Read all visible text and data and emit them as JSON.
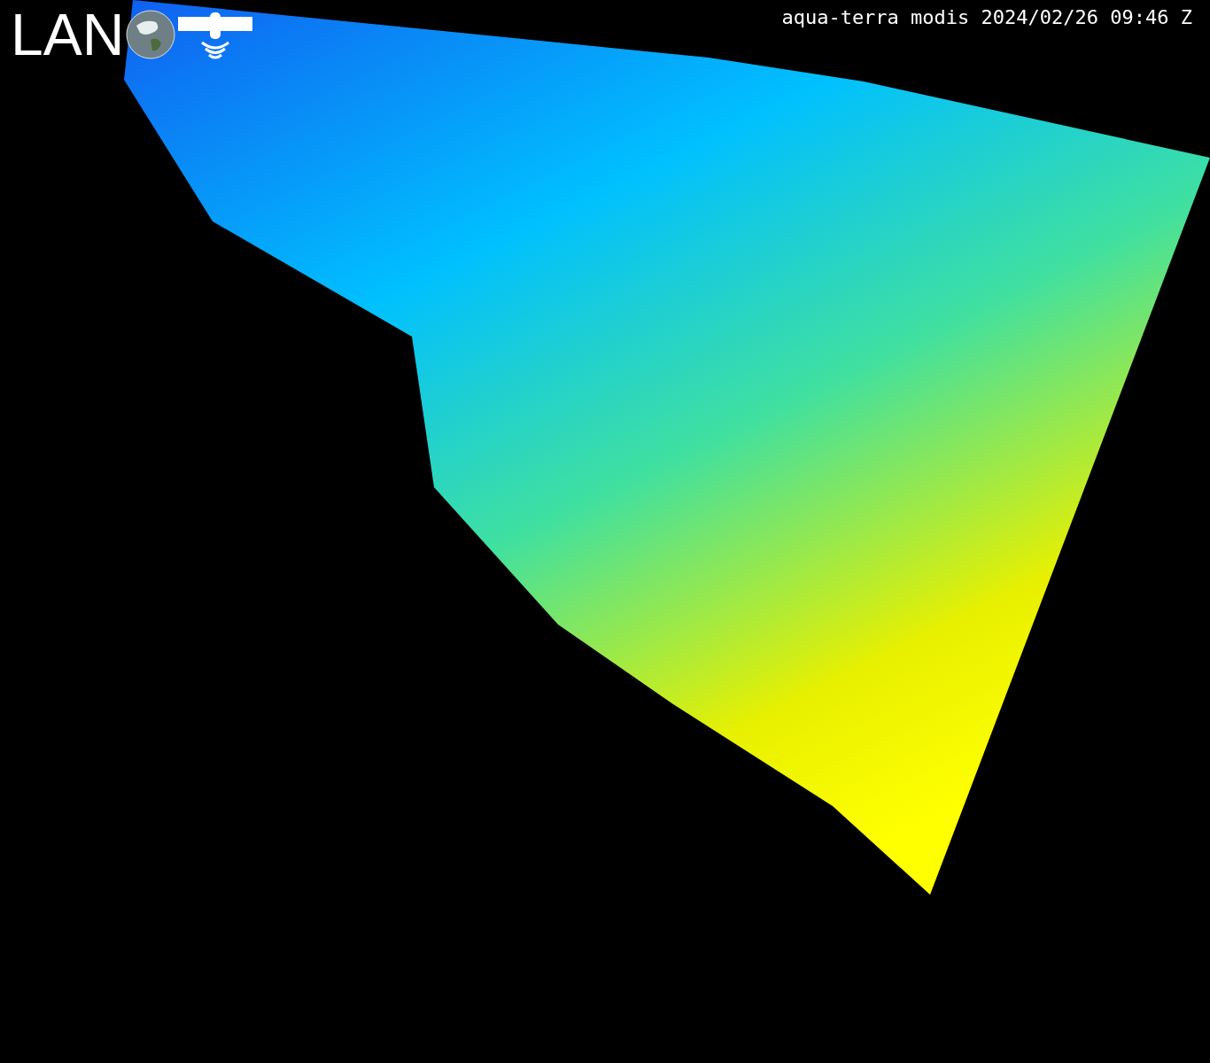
{
  "logo": {
    "text": "LAN"
  },
  "caption": "aqua-terra modis 2024/02/26 09:46 Z"
}
